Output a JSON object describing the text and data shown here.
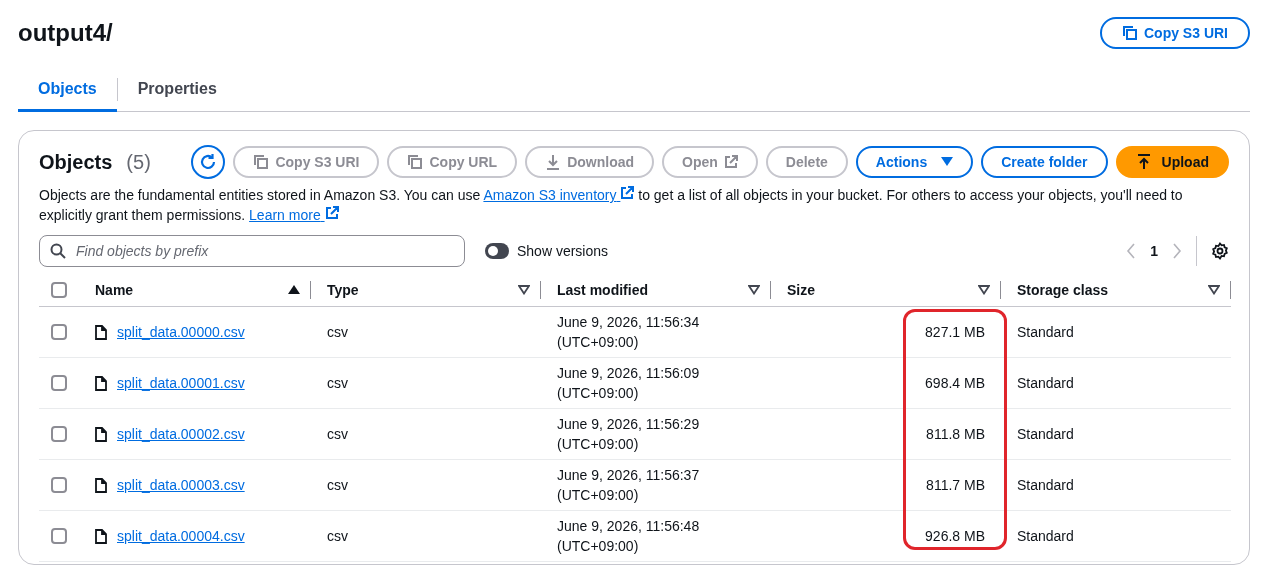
{
  "header": {
    "title": "output4/",
    "copy_button": "Copy S3 URI"
  },
  "tabs": [
    {
      "label": "Objects",
      "selected": true
    },
    {
      "label": "Properties",
      "selected": false
    }
  ],
  "panel": {
    "title": "Objects",
    "count": "(5)",
    "actions": [
      {
        "kind": "refresh",
        "disabled": false
      },
      {
        "kind": "copy",
        "label": "Copy S3 URI",
        "disabled": true
      },
      {
        "kind": "copy",
        "label": "Copy URL",
        "disabled": true
      },
      {
        "kind": "download",
        "label": "Download",
        "disabled": true
      },
      {
        "kind": "external",
        "label": "Open",
        "disabled": true
      },
      {
        "kind": "plain",
        "label": "Delete",
        "disabled": true
      },
      {
        "kind": "dropdown",
        "label": "Actions",
        "disabled": false
      },
      {
        "kind": "plain",
        "label": "Create folder",
        "disabled": false
      },
      {
        "kind": "primary",
        "label": "Upload",
        "disabled": false
      }
    ],
    "description": [
      {
        "kind": "text",
        "text": "Objects are the fundamental entities stored in Amazon S3. You can use "
      },
      {
        "kind": "link",
        "text": "Amazon S3 inventory"
      },
      {
        "kind": "text",
        "text": " to get a list of all objects in your bucket. For others to access your objects, you'll need to explicitly grant them permissions. "
      },
      {
        "kind": "link",
        "text": "Learn more"
      }
    ],
    "search": {
      "placeholder": "Find objects by prefix"
    },
    "show_versions": {
      "label": "Show versions",
      "on": false
    },
    "pagination": {
      "page": "1"
    }
  },
  "table": {
    "all_checked": false,
    "columns": [
      {
        "label": "Name",
        "sorted": true,
        "highlighted": false
      },
      {
        "label": "Type",
        "sorted": false,
        "highlighted": false
      },
      {
        "label": "Last modified",
        "sorted": false,
        "highlighted": false
      },
      {
        "label": "Size",
        "sorted": false,
        "highlighted": true
      },
      {
        "label": "Storage class",
        "sorted": false,
        "highlighted": false
      }
    ],
    "rows": [
      {
        "checked": false,
        "name": "split_data.00000.csv",
        "type": "csv",
        "modified": "June 9, 2026, 11:56:34",
        "zone": "(UTC+09:00)",
        "size": "827.1 MB",
        "storage": "Standard"
      },
      {
        "checked": false,
        "name": "split_data.00001.csv",
        "type": "csv",
        "modified": "June 9, 2026, 11:56:09",
        "zone": "(UTC+09:00)",
        "size": "698.4 MB",
        "storage": "Standard"
      },
      {
        "checked": false,
        "name": "split_data.00002.csv",
        "type": "csv",
        "modified": "June 9, 2026, 11:56:29",
        "zone": "(UTC+09:00)",
        "size": "811.8 MB",
        "storage": "Standard"
      },
      {
        "checked": false,
        "name": "split_data.00003.csv",
        "type": "csv",
        "modified": "June 9, 2026, 11:56:37",
        "zone": "(UTC+09:00)",
        "size": "811.7 MB",
        "storage": "Standard"
      },
      {
        "checked": false,
        "name": "split_data.00004.csv",
        "type": "csv",
        "modified": "June 9, 2026, 11:56:48",
        "zone": "(UTC+09:00)",
        "size": "926.8 MB",
        "storage": "Standard"
      }
    ]
  }
}
